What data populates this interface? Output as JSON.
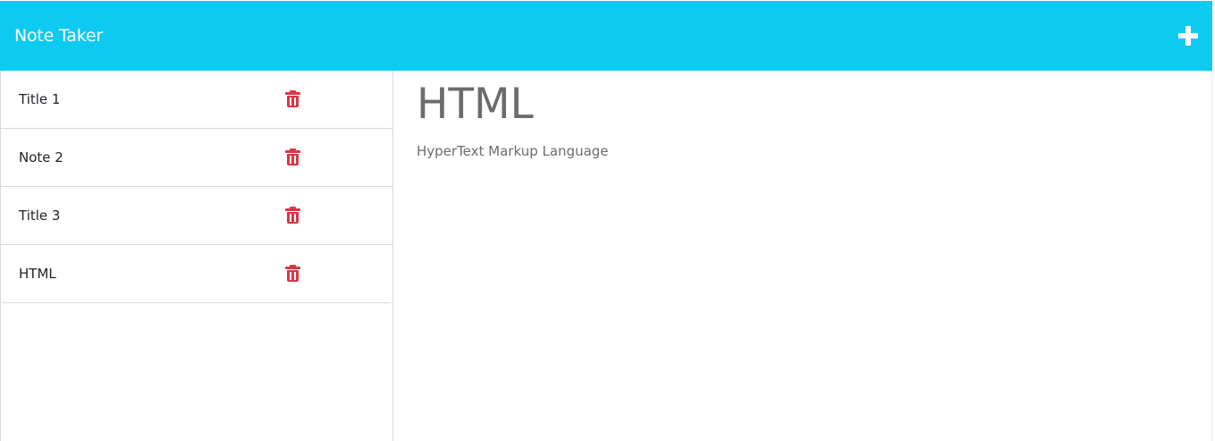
{
  "app": {
    "title": "Note Taker"
  },
  "header": {
    "add_icon": "plus-icon"
  },
  "notes": [
    {
      "title": "Title 1",
      "delete_icon": "trash-icon"
    },
    {
      "title": "Note 2",
      "delete_icon": "trash-icon"
    },
    {
      "title": "Title 3",
      "delete_icon": "trash-icon"
    },
    {
      "title": "HTML",
      "delete_icon": "trash-icon"
    }
  ],
  "active_note": {
    "title": "HTML",
    "text": "HyperText Markup Language"
  },
  "colors": {
    "navbar": "#0dcaf0",
    "delete": "#dc3545",
    "note_text": "#6c6c6c"
  }
}
